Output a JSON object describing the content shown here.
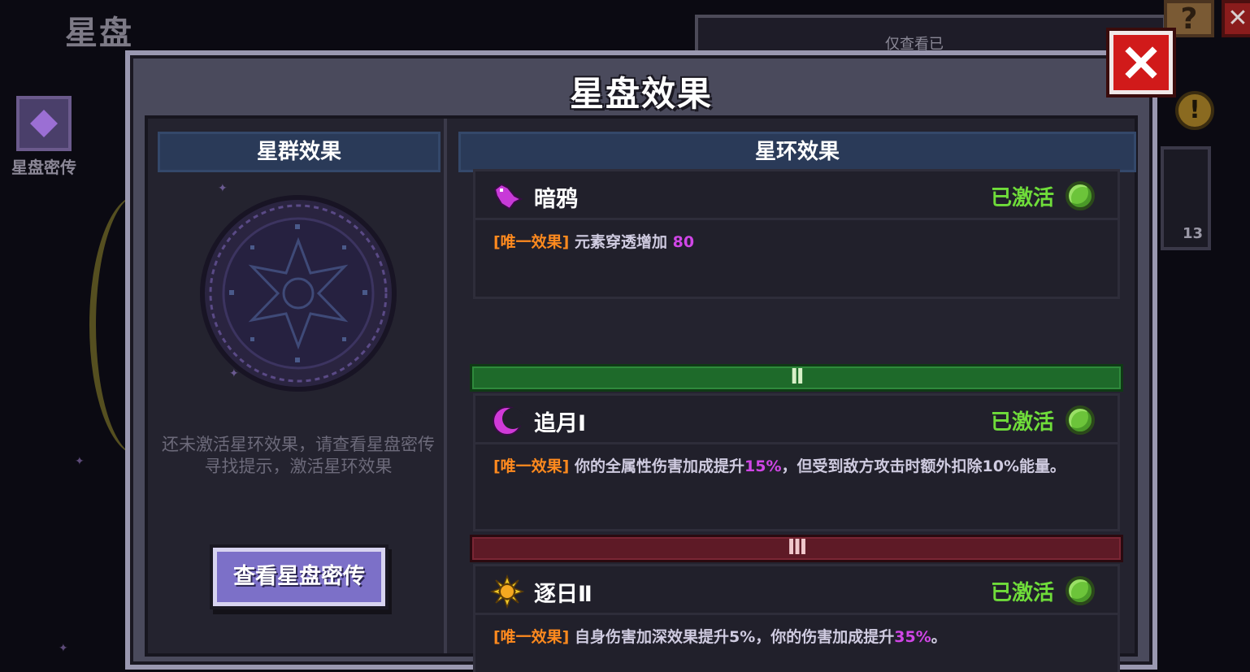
{
  "background": {
    "screen_title": "星盘",
    "secret_label": "星盘密传",
    "top_filter": "仅查看已",
    "help_icon": "question-mark-icon",
    "alert_icon": "exclamation-icon",
    "item_count": "13"
  },
  "dialog": {
    "title": "星盘效果",
    "close_icon": "close-x-icon"
  },
  "left": {
    "header": "星群效果",
    "hint": "还未激活星环效果，请查看星盘密传寻找提示，激活星环效果",
    "button": "查看星盘密传"
  },
  "right": {
    "header": "星环效果",
    "effects": [
      {
        "icon": "crow-icon",
        "name": "暗鸦",
        "status": "已激活",
        "tag": "[唯一效果]",
        "desc_parts": [
          "元素穿透增加 ",
          "80",
          ""
        ]
      },
      {
        "icon": "crescent-moon-icon",
        "name": "追月Ⅰ",
        "status": "已激活",
        "tag": "[唯一效果]",
        "desc_parts": [
          "你的全属性伤害加成提升",
          "15%",
          "，但受到敌方攻击时额外扣除10%能量。"
        ]
      },
      {
        "icon": "sun-icon",
        "name": "逐日Ⅱ",
        "status": "已激活",
        "tag": "[唯一效果]",
        "desc_parts": [
          "自身伤害加深效果提升5%，你的伤害加成提升",
          "35%",
          "。"
        ]
      }
    ],
    "tiers": [
      "Ⅱ",
      "Ⅲ"
    ]
  },
  "colors": {
    "tag": "#ff8a1e",
    "highlight": "#d046e6",
    "status": "#6fdc3a",
    "tier2": "#1e6a2a",
    "tier3": "#5e1a26"
  }
}
